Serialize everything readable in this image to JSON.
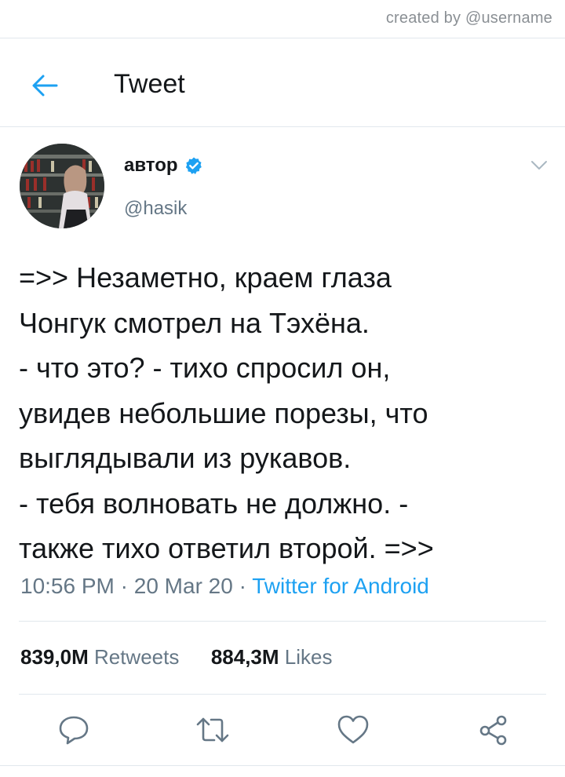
{
  "watermark": "created by @username",
  "header": {
    "title": "Tweet",
    "back_icon": "arrow-left-icon"
  },
  "tweet": {
    "author": {
      "name": "автор",
      "handle": "@hasik",
      "verified": true
    },
    "text": "=>> Незаметно, краем глаза\nЧонгук смотрел на Тэхёна.\n- что это? - тихо спросил он,\nувидев небольшие порезы, что\nвыглядывали из рукавов.\n- тебя волновать не должно. -\nтакже тихо ответил второй. =>>",
    "time": "10:56 PM",
    "date": "20 Mar 20",
    "source": "Twitter for Android",
    "separator": "·"
  },
  "stats": {
    "retweets_count": "839,0M",
    "retweets_label": "Retweets",
    "likes_count": "884,3M",
    "likes_label": "Likes"
  },
  "actions": [
    "reply-icon",
    "retweet-icon",
    "heart-icon",
    "share-icon"
  ],
  "colors": {
    "accent": "#1da1f2",
    "text": "#14171a",
    "secondary": "#657786",
    "divider": "#e1e8ed"
  }
}
